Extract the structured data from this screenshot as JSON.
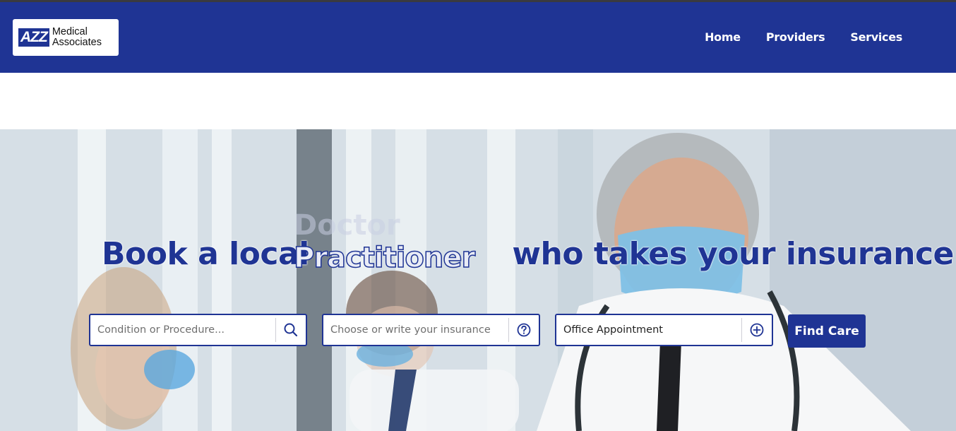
{
  "brand": {
    "mark": "AZZ",
    "line1": "Medical",
    "line2": "Associates"
  },
  "nav": {
    "home": "Home",
    "providers": "Providers",
    "services": "Services"
  },
  "hero": {
    "headline_prefix": "Book a local",
    "headline_suffix": "who takes your insurance",
    "rotating_previous": "Doctor",
    "rotating_current": "Practitioner"
  },
  "search": {
    "condition_placeholder": "Condition or Procedure...",
    "insurance_placeholder": "Choose or write your insurance",
    "appointment_value": "Office Appointment",
    "submit_label": "Find Care"
  },
  "colors": {
    "brand_blue": "#1f3494",
    "white": "#ffffff"
  },
  "icons": {
    "condition": "search-icon",
    "insurance": "help-circle-icon",
    "appointment": "plus-circle-icon"
  }
}
